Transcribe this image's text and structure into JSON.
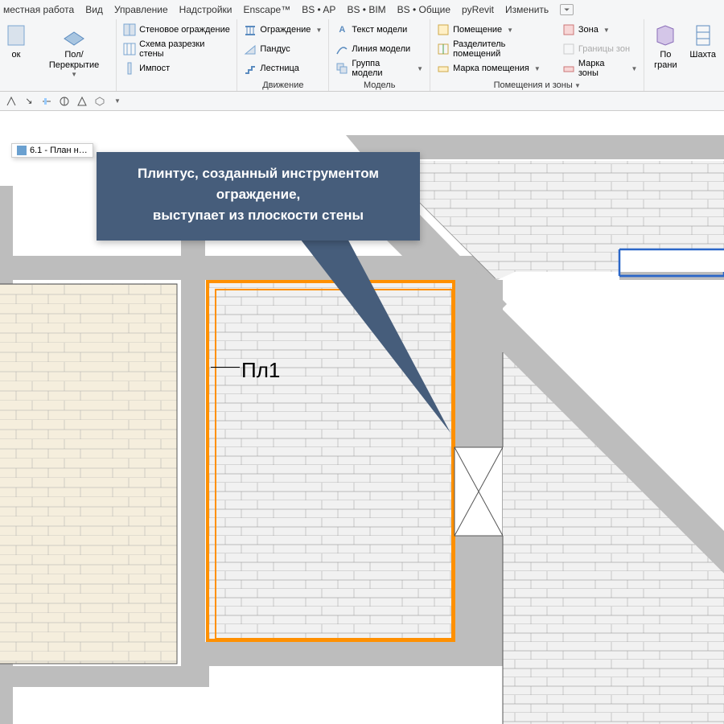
{
  "menubar": {
    "items": [
      "местная работа",
      "Вид",
      "Управление",
      "Надстройки",
      "Enscape™",
      "BS • AP",
      "BS • BIM",
      "BS • Общие",
      "pyRevit",
      "Изменить"
    ]
  },
  "ribbon": {
    "panels": [
      {
        "label": "",
        "big": [
          {
            "label": "ок"
          },
          {
            "label": "Пол/Перекрытие"
          }
        ]
      },
      {
        "label": "",
        "small": [
          "Стеновое ограждение",
          "Схема разрезки стены",
          "Импост"
        ]
      },
      {
        "label": "Движение",
        "big": [],
        "small": [
          "Ограждение",
          "Пандус",
          "Лестница"
        ]
      },
      {
        "label": "Модель",
        "small": [
          "Текст модели",
          "Линия модели",
          "Группа модели"
        ]
      },
      {
        "label": "Помещения и зоны",
        "small_left": [
          "Помещение",
          "Разделитель помещений",
          "Марка помещения"
        ],
        "small_right": [
          "Зона",
          "Границы зон",
          "Марка зоны"
        ]
      },
      {
        "label": "",
        "big": [
          {
            "label": "По\nграни"
          },
          {
            "label": "Шахта"
          }
        ]
      }
    ]
  },
  "tab": {
    "label": "6.1 - План н…"
  },
  "callout": {
    "line1": "Плинтус, созданный инструментом",
    "line2": "ограждение,",
    "line3": "выступает из плоскости стены"
  },
  "room_label": "Пл1"
}
